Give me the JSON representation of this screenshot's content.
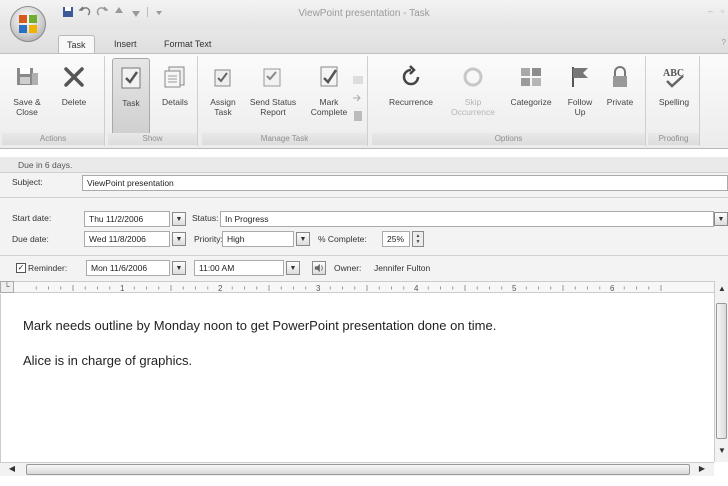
{
  "window": {
    "title": "ViewPoint presentation - Task",
    "help_glyph": "?"
  },
  "quick_access": {
    "icons": [
      "save-icon",
      "undo-icon",
      "redo-icon",
      "up-arrow-icon",
      "down-arrow-icon",
      "customize-icon"
    ]
  },
  "tabs": [
    {
      "label": "Task",
      "active": true
    },
    {
      "label": "Insert",
      "active": false
    },
    {
      "label": "Format Text",
      "active": false
    }
  ],
  "ribbon": {
    "groups": {
      "actions": "Actions",
      "show": "Show",
      "manage_task": "Manage Task",
      "options": "Options",
      "proofing": "Proofing"
    },
    "buttons": {
      "save_close": "Save &\nClose",
      "delete": "Delete",
      "task": "Task",
      "details": "Details",
      "assign_task": "Assign\nTask",
      "send_status_report": "Send Status\nReport",
      "mark_complete": "Mark\nComplete",
      "recurrence": "Recurrence",
      "skip_occurrence": "Skip\nOccurrence",
      "categorize": "Categorize",
      "follow_up": "Follow\nUp",
      "private": "Private",
      "spelling": "Spelling"
    }
  },
  "info_bar": "Due in 6 days.",
  "form": {
    "subject_label": "Subject:",
    "subject_value": "ViewPoint presentation",
    "start_date_label": "Start date:",
    "start_date_value": "Thu 11/2/2006",
    "due_date_label": "Due date:",
    "due_date_value": "Wed 11/8/2006",
    "status_label": "Status:",
    "status_value": "In Progress",
    "priority_label": "Priority:",
    "priority_value": "High",
    "percent_label": "% Complete:",
    "percent_value": "25%",
    "reminder_label": "Reminder:",
    "reminder_checked": true,
    "reminder_date": "Mon 11/6/2006",
    "reminder_time": "11:00 AM",
    "owner_label": "Owner:",
    "owner_value": "Jennifer Fulton"
  },
  "ruler": {
    "marks": [
      "1",
      "2",
      "3",
      "4",
      "5",
      "6"
    ]
  },
  "notes": [
    "Mark needs outline by Monday noon to get PowerPoint presentation done on time.",
    "Alice is in charge of graphics."
  ]
}
